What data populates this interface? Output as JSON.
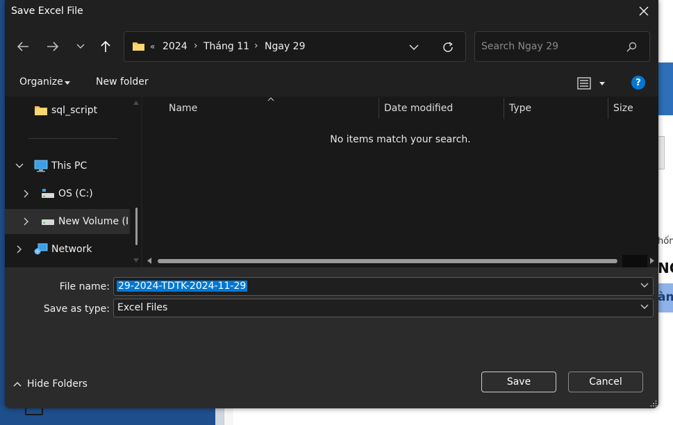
{
  "window": {
    "title": "Save Excel File"
  },
  "breadcrumb": {
    "overflow": "«",
    "items": [
      "2024",
      "Tháng 11",
      "Ngay 29"
    ]
  },
  "search": {
    "placeholder": "Search Ngay 29"
  },
  "toolbar": {
    "organize": "Organize",
    "new_folder": "New folder"
  },
  "nav_tree": {
    "items": [
      {
        "label": "sql_script",
        "icon": "folder-icon"
      },
      {
        "label": "This PC",
        "icon": "pc-icon"
      },
      {
        "label": "OS (C:)",
        "icon": "drive-icon"
      },
      {
        "label": "New Volume (I",
        "icon": "drive-icon"
      },
      {
        "label": "Network",
        "icon": "network-icon"
      }
    ]
  },
  "columns": [
    "Name",
    "Date modified",
    "Type",
    "Size"
  ],
  "empty_message": "No items match your search.",
  "form": {
    "file_name_label": "File name:",
    "file_name_value": "29-2024-TDTK-2024-11-29",
    "type_label": "Save as type:",
    "type_value": "Excel Files"
  },
  "buttons": {
    "save": "Save",
    "cancel": "Cancel",
    "hide_folders": "Hide Folders"
  },
  "background": {
    "fragment1": "hốn",
    "fragment2": "NC",
    "fragment3": "àn"
  },
  "colors": {
    "dialog_bg": "#202020",
    "pane_bg": "#191919",
    "selection": "#0078d4",
    "help": "#0078d4",
    "folder": "#f2c14e"
  }
}
